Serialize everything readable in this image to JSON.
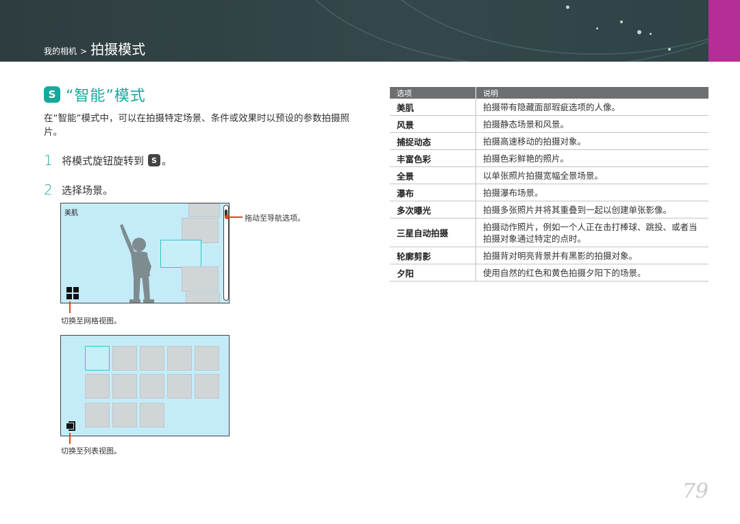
{
  "header": {
    "breadcrumb_small": "我的相机",
    "breadcrumb_sep": ">",
    "breadcrumb_big": "拍摄模式"
  },
  "title": {
    "icon_letter": "S",
    "text": "“智能”模式"
  },
  "intro": "在“智能”模式中，可以在拍摄特定场景、条件或效果时以预设的参数拍摄照片。",
  "steps": [
    {
      "num": "1",
      "text_before": "将模式旋钮旋转到",
      "icon_letter": "S",
      "text_after": "。"
    },
    {
      "num": "2",
      "text": "选择场景。"
    }
  ],
  "screen1": {
    "scene_label": "美肌",
    "callout_scroll": "拖动至导航选项。",
    "callout_grid": "切换至网格视图。"
  },
  "screen2": {
    "callout_list": "切换至列表视图。"
  },
  "table": {
    "headers": [
      "选项",
      "说明"
    ],
    "rows": [
      {
        "option": "美肌",
        "desc": "拍摄带有隐藏面部瑕疵选项的人像。"
      },
      {
        "option": "风景",
        "desc": "拍摄静态场景和风景。"
      },
      {
        "option": "捕捉动态",
        "desc": "拍摄高速移动的拍摄对象。"
      },
      {
        "option": "丰富色彩",
        "desc": "拍摄色彩鲜艳的照片。"
      },
      {
        "option": "全景",
        "desc": "以单张照片拍摄宽幅全景场景。"
      },
      {
        "option": "瀑布",
        "desc": "拍摄瀑布场景。"
      },
      {
        "option": "多次曝光",
        "desc": "拍摄多张照片并将其重叠到一起以创建单张影像。"
      },
      {
        "option": "三星自动拍摄",
        "desc": "拍摄动作照片，例如一个人正在击打棒球、跳投、或者当拍摄对象通过特定的点时。"
      },
      {
        "option": "轮廓剪影",
        "desc": "拍摄背对明亮背景并有黑影的拍摄对象。"
      },
      {
        "option": "夕阳",
        "desc": "使用自然的红色和黄色拍摄夕阳下的场景。"
      }
    ]
  },
  "page_number": "79",
  "colors": {
    "accent": "#17a89c",
    "header_bg": "#34474a",
    "magenta_tab": "#b52e97",
    "screen_bg": "#c4ecf8",
    "callout": "#e0451a"
  }
}
